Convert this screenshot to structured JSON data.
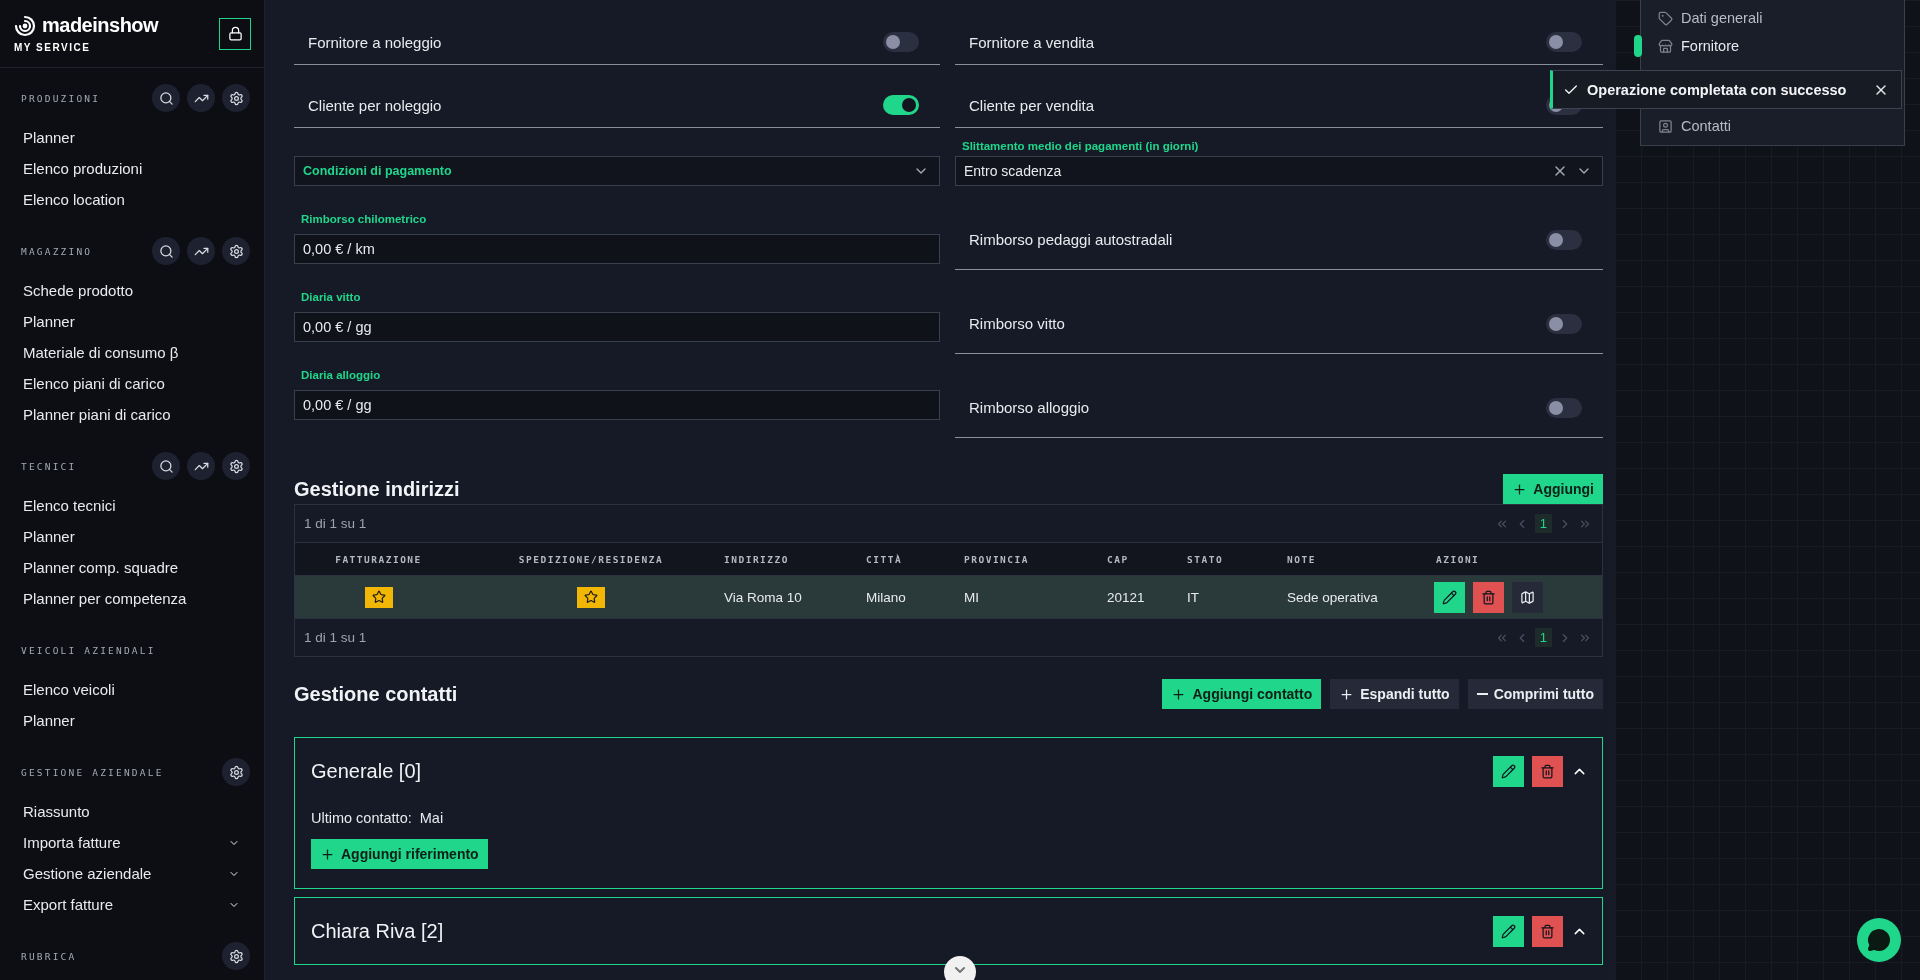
{
  "brand": {
    "name": "madeinshow",
    "subtitle": "MY SERVICE"
  },
  "sidebar": {
    "sections": [
      {
        "title": "PRODUZIONI",
        "search": true,
        "stats": true,
        "settings": true,
        "items": [
          {
            "label": "Planner",
            "expandable": false
          },
          {
            "label": "Elenco produzioni",
            "expandable": false
          },
          {
            "label": "Elenco location",
            "expandable": false
          }
        ]
      },
      {
        "title": "MAGAZZINO",
        "search": true,
        "stats": true,
        "settings": true,
        "items": [
          {
            "label": "Schede prodotto",
            "expandable": false
          },
          {
            "label": "Planner",
            "expandable": false
          },
          {
            "label": "Materiale di consumo β",
            "expandable": false
          },
          {
            "label": "Elenco piani di carico",
            "expandable": false
          },
          {
            "label": "Planner piani di carico",
            "expandable": false
          }
        ]
      },
      {
        "title": "TECNICI",
        "search": true,
        "stats": true,
        "settings": true,
        "items": [
          {
            "label": "Elenco tecnici",
            "expandable": false
          },
          {
            "label": "Planner",
            "expandable": false
          },
          {
            "label": "Planner comp. squadre",
            "expandable": false
          },
          {
            "label": "Planner per competenza",
            "expandable": false
          }
        ]
      },
      {
        "title": "VEICOLI AZIENDALI",
        "search": false,
        "stats": false,
        "settings": false,
        "items": [
          {
            "label": "Elenco veicoli",
            "expandable": false
          },
          {
            "label": "Planner",
            "expandable": false
          }
        ]
      },
      {
        "title": "GESTIONE AZIENDALE",
        "search": false,
        "stats": false,
        "settings": true,
        "items": [
          {
            "label": "Riassunto",
            "expandable": false
          },
          {
            "label": "Importa fatture",
            "expandable": true
          },
          {
            "label": "Gestione aziendale",
            "expandable": true
          },
          {
            "label": "Export fatture",
            "expandable": true
          }
        ]
      },
      {
        "title": "RUBRICA",
        "search": false,
        "stats": false,
        "settings": true
      }
    ]
  },
  "form": {
    "toggles": [
      {
        "label": "Fornitore a noleggio",
        "on": false
      },
      {
        "label": "Fornitore a vendita",
        "on": false
      },
      {
        "label": "Cliente per noleggio",
        "on": true
      },
      {
        "label": "Cliente per vendita",
        "on": false
      }
    ],
    "payment_terms": {
      "placeholder": "Condizioni di pagamento"
    },
    "payment_delay": {
      "label": "Slittamento medio dei pagamenti (in giorni)",
      "value": "Entro scadenza"
    },
    "amount_fields": [
      {
        "label": "Rimborso chilometrico",
        "value": "0,00 € / km"
      },
      {
        "label": "Diaria vitto",
        "value": "0,00 € / gg"
      },
      {
        "label": "Diaria alloggio",
        "value": "0,00 € / gg"
      }
    ],
    "reimbursements": [
      {
        "label": "Rimborso pedaggi autostradali",
        "on": false
      },
      {
        "label": "Rimborso vitto",
        "on": false
      },
      {
        "label": "Rimborso alloggio",
        "on": false
      }
    ]
  },
  "addresses": {
    "title": "Gestione indirizzi",
    "add_label": "Aggiungi",
    "pagination": "1 di 1 su 1",
    "page": "1",
    "columns": [
      "FATTURAZIONE",
      "SPEDIZIONE/RESIDENZA",
      "INDIRIZZO",
      "CITTÀ",
      "PROVINCIA",
      "CAP",
      "STATO",
      "NOTE",
      "AZIONI"
    ],
    "rows": [
      {
        "selected": true,
        "billing_default": true,
        "shipping_default": true,
        "cells": [
          "",
          "",
          "Via Roma 10",
          "Milano",
          "MI",
          "20121",
          "IT",
          "Sede operativa"
        ]
      }
    ],
    "footer_pagination": "1 di 1 su 1",
    "footer_page": "1"
  },
  "contacts": {
    "title": "Gestione contatti",
    "actions": [
      {
        "label": "Aggiungi contatto",
        "kind": "add"
      },
      {
        "label": "Espandi tutto",
        "kind": "expand"
      },
      {
        "label": "Comprimi tutto",
        "kind": "collapse"
      }
    ],
    "groups": [
      {
        "title": "Generale [0]",
        "expanded": true,
        "last_contact_label": "Ultimo contatto:",
        "last_contact": "Mai",
        "add_label": "Aggiungi riferimento"
      },
      {
        "title": "Chiara Riva [2]",
        "expanded": true
      }
    ]
  },
  "nav_panel": {
    "items": [
      {
        "label": "Dati generali",
        "selected": false
      },
      {
        "label": "Fornitore",
        "selected": true
      },
      {
        "label": "Contatti",
        "selected": false
      }
    ]
  },
  "toast": {
    "message": "Operazione completata con successo"
  }
}
